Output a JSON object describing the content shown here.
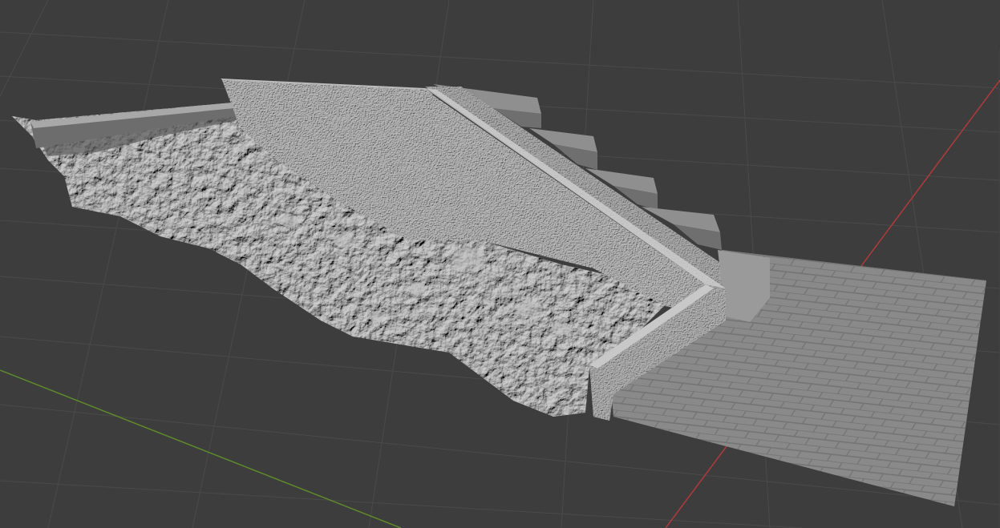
{
  "viewport": {
    "background": "#3d3d3d",
    "grid_color": "#4a4a4a",
    "x_axis_color": "#b23a3a",
    "y_axis_color": "#5d8a2a",
    "mesh_base_color": "#8e8e8e",
    "mesh_highlight_color": "#c4c4c4",
    "mesh_shadow_color": "#4e4e4e"
  },
  "scene": {
    "objects": [
      {
        "name": "rubble-embankment"
      },
      {
        "name": "retaining-wall"
      },
      {
        "name": "concrete-staircase"
      },
      {
        "name": "brick-pavement"
      },
      {
        "name": "curb-edge"
      }
    ]
  }
}
